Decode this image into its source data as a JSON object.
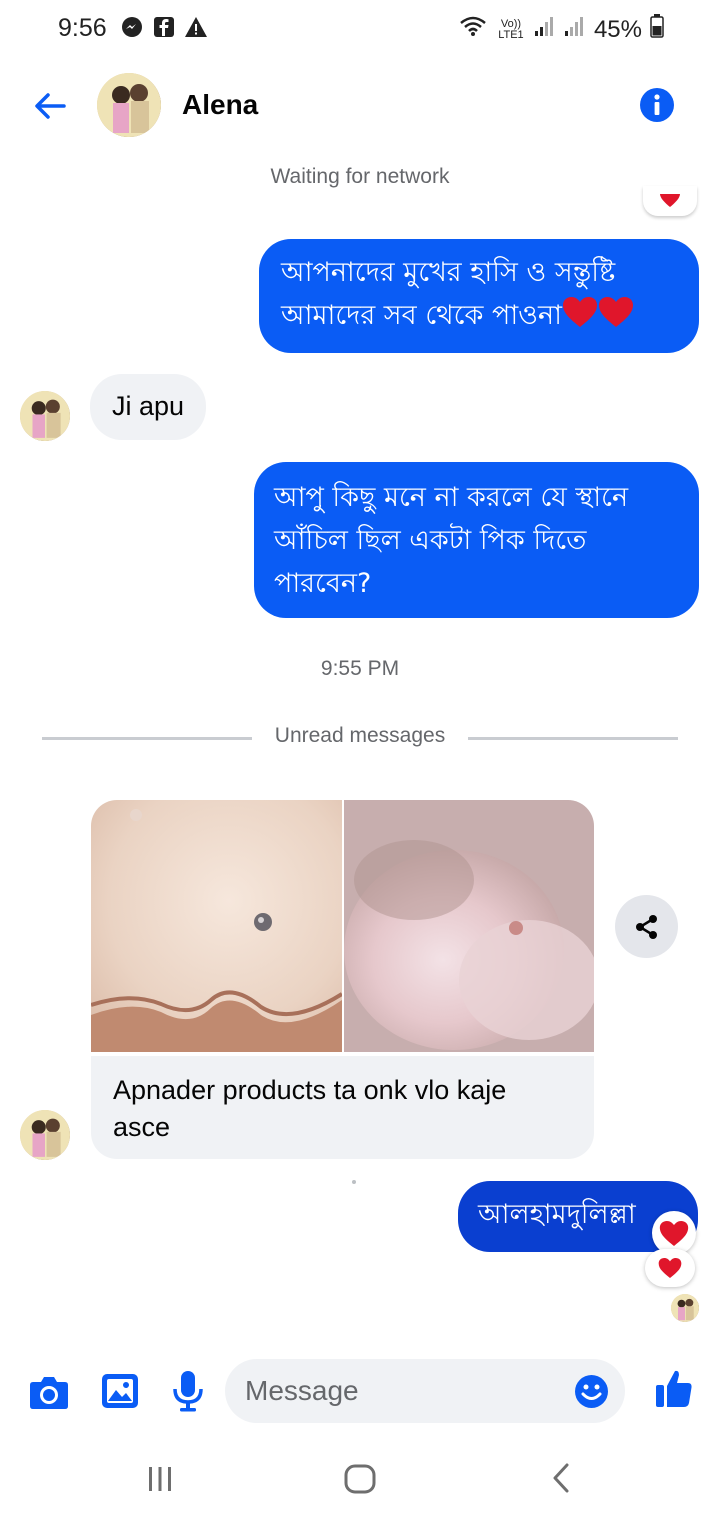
{
  "status_bar": {
    "time": "9:56",
    "signal_label": "Vo)) LTE1",
    "battery": "45%"
  },
  "header": {
    "contact_name": "Alena",
    "network_status": "Waiting for network"
  },
  "messages": {
    "out1": [
      "আপনাদের মুখের হাসি ও সন্তুষ্টি",
      "আমাদের সব থেকে পাওনা"
    ],
    "in1": "Ji apu",
    "out2": [
      "আপু কিছু মনে না করলে যে স্থানে",
      "আঁচিল ছিল একটা পিক দিতে",
      "পারবেন?"
    ],
    "time_separator": "9:55 PM",
    "unread_label": "Unread messages",
    "in2": [
      "Apnader products ta onk vlo kaje",
      "asce"
    ],
    "out3": "আলহামদুলিল্লা"
  },
  "composer": {
    "placeholder": "Message"
  },
  "colors": {
    "accent": "#0a5cf5",
    "incoming_bubble": "#f0f2f5",
    "meta_text": "#65676b"
  }
}
